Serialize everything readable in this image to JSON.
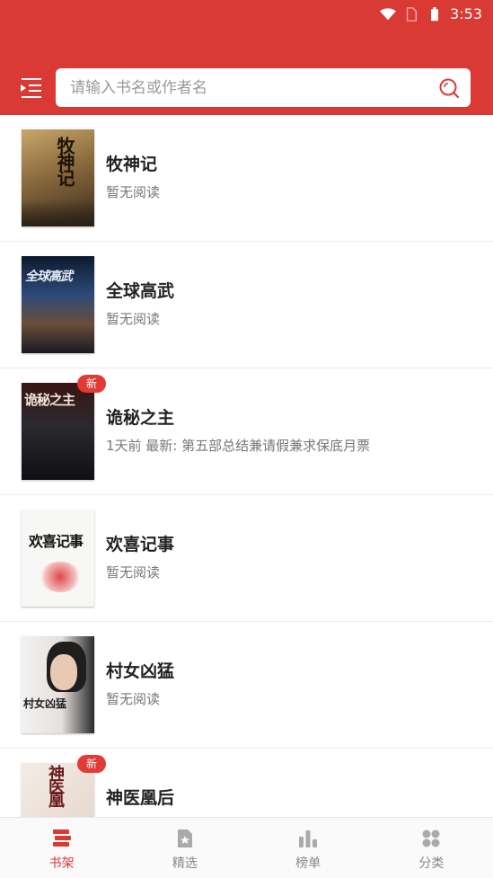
{
  "status_bar": {
    "time": "3:53"
  },
  "search": {
    "placeholder": "请输入书名或作者名"
  },
  "books": [
    {
      "title": "牧神记",
      "status": "暂无阅读",
      "badge": "",
      "cover_text": "牧神记"
    },
    {
      "title": "全球高武",
      "status": "暂无阅读",
      "badge": "",
      "cover_text": "全球高武"
    },
    {
      "title": "诡秘之主",
      "status": "1天前 最新: 第五部总结兼请假兼求保底月票",
      "badge": "新",
      "cover_text": "诡秘之主"
    },
    {
      "title": "欢喜记事",
      "status": "暂无阅读",
      "badge": "",
      "cover_text": "欢喜记事"
    },
    {
      "title": "村女凶猛",
      "status": "暂无阅读",
      "badge": "",
      "cover_text": "村女凶猛"
    },
    {
      "title": "神医凰后",
      "status": "",
      "badge": "新",
      "cover_text": "神医凰"
    }
  ],
  "tabs": [
    {
      "label": "书架",
      "icon": "bookshelf-icon",
      "active": true
    },
    {
      "label": "精选",
      "icon": "featured-icon",
      "active": false
    },
    {
      "label": "榜单",
      "icon": "ranking-icon",
      "active": false
    },
    {
      "label": "分类",
      "icon": "category-icon",
      "active": false
    }
  ],
  "colors": {
    "brand": "#d93a33",
    "badge": "#e23a35"
  }
}
